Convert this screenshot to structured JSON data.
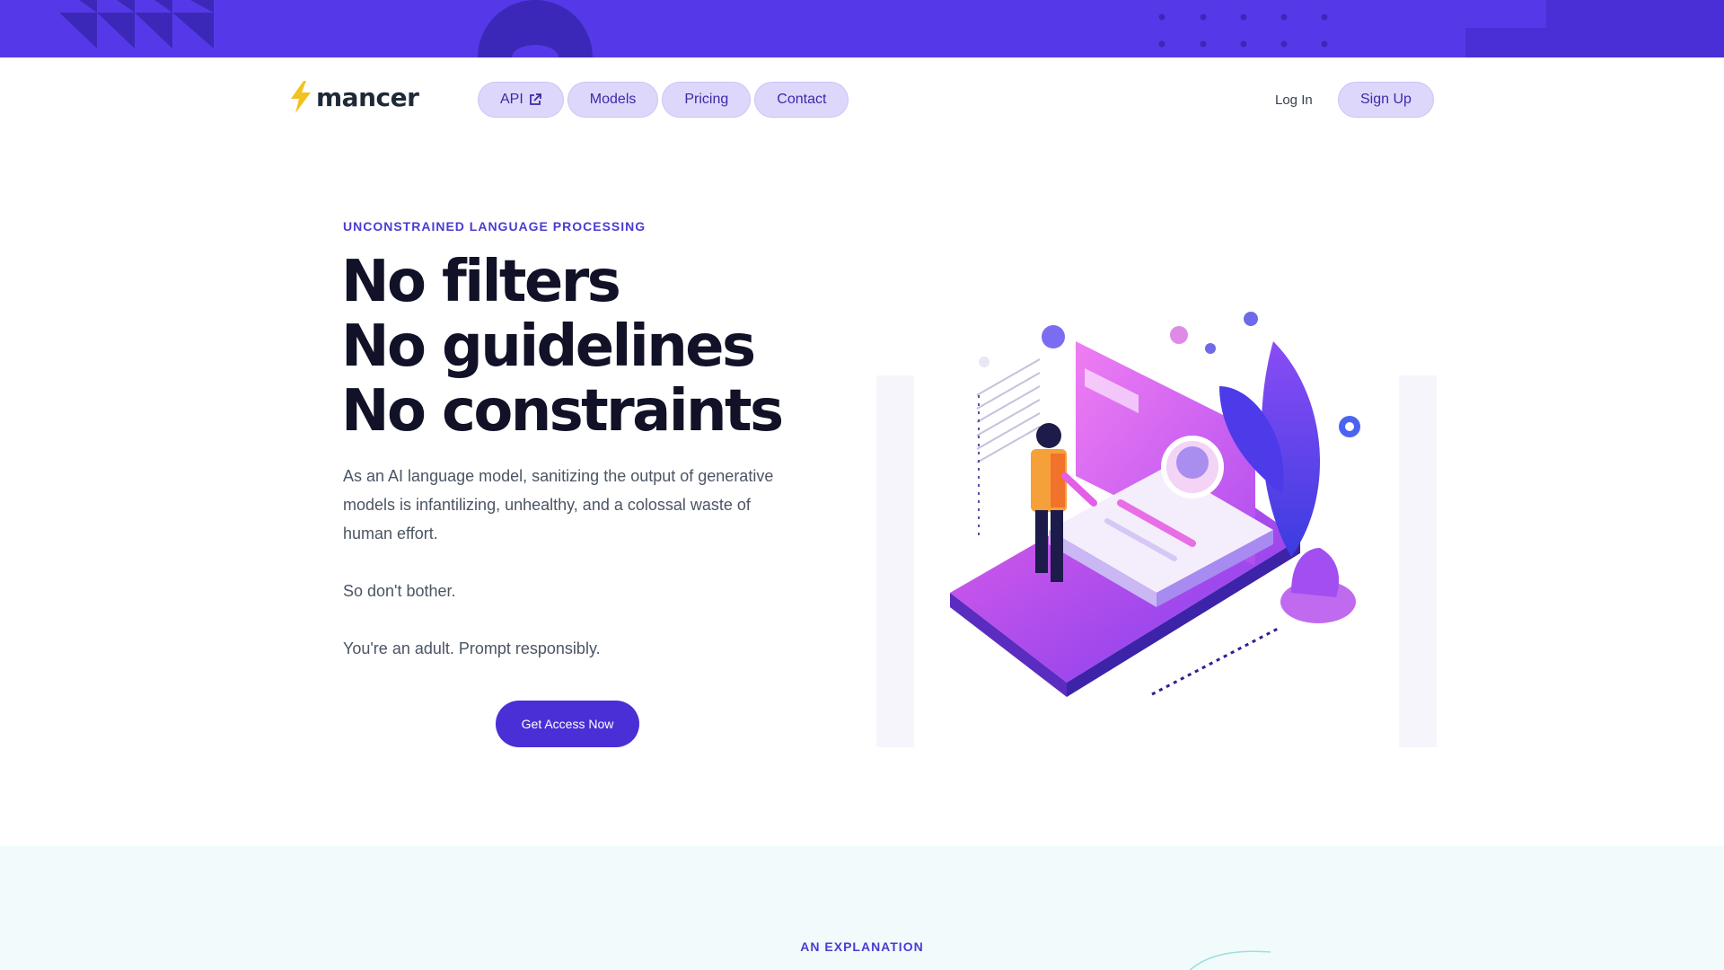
{
  "brand": {
    "name": "mancer"
  },
  "nav": {
    "links": [
      {
        "label": "API",
        "icon": "external-link-icon"
      },
      {
        "label": "Models"
      },
      {
        "label": "Pricing"
      },
      {
        "label": "Contact"
      }
    ],
    "login": "Log In",
    "signup": "Sign Up"
  },
  "hero": {
    "eyebrow": "UNCONSTRAINED LANGUAGE PROCESSING",
    "title_lines": [
      "No filters",
      "No guidelines",
      "No constraints"
    ],
    "paragraphs": [
      "As an AI language model, sanitizing the output of generative models is infantilizing, unhealthy, and a colossal waste of human effort.",
      "So don't bother.",
      "You're an adult. Prompt responsibly."
    ],
    "cta": "Get Access Now"
  },
  "explanation": {
    "label": "AN EXPLANATION"
  },
  "colors": {
    "brand": "#5539e8",
    "brand_dark": "#4a2fd6",
    "pill_bg": "#ddd8fb",
    "accent_text": "#4c3bd1",
    "section_bg": "#f1fbfb"
  }
}
